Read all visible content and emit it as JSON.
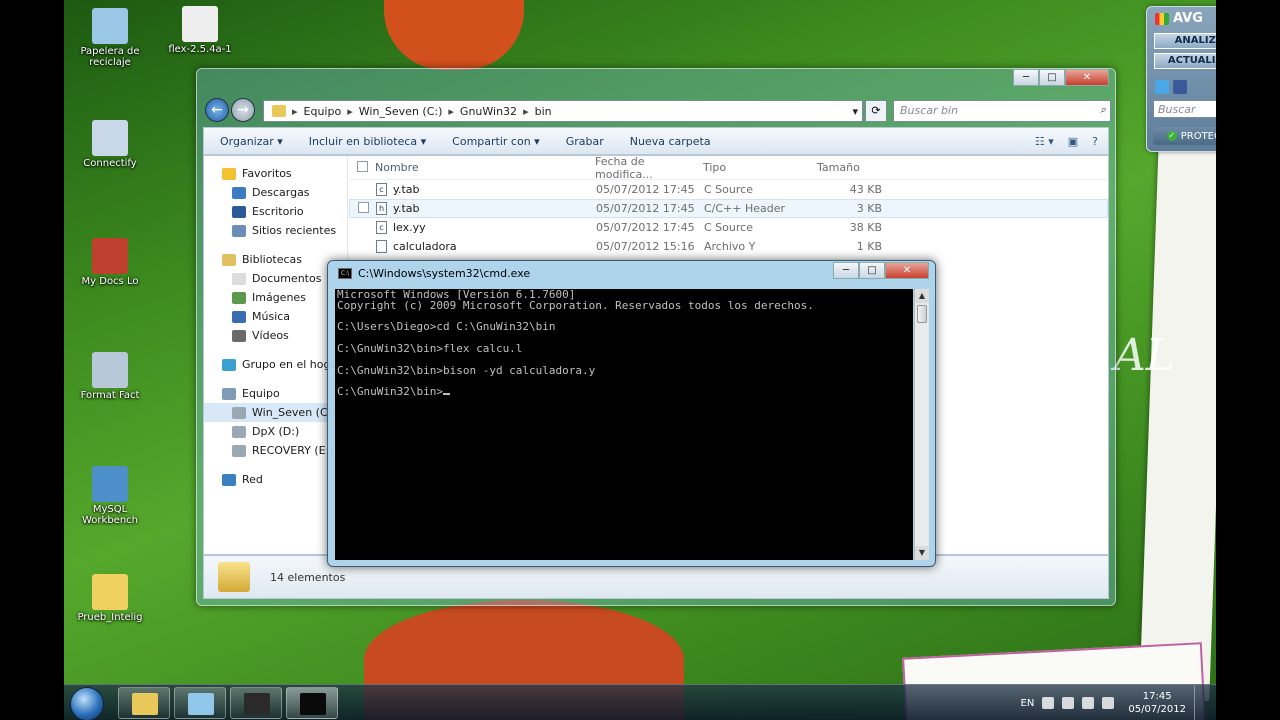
{
  "desktop": {
    "icons": [
      {
        "label": "Papelera de reciclaje",
        "color": "#9cc8e8"
      },
      {
        "label": "flex-2.5.4a-1",
        "color": "#eeeeee"
      },
      {
        "label": "Connectify",
        "color": "#c8d8e8"
      },
      {
        "label": "My Docs Lo",
        "color": "#c04030"
      },
      {
        "label": "Format Fact",
        "color": "#b8c8d8"
      },
      {
        "label": "MySQL Workbench",
        "color": "#4d8fc8"
      },
      {
        "label": "Prueb_Intelig",
        "color": "#f0d060"
      }
    ]
  },
  "explorer": {
    "caption": {
      "minimize": "─",
      "maximize": "□",
      "close": "✕"
    },
    "breadcrumb": [
      "Equipo",
      "Win_Seven (C:)",
      "GnuWin32",
      "bin"
    ],
    "search_placeholder": "Buscar bin",
    "toolbar": [
      "Organizar ▾",
      "Incluir en biblioteca ▾",
      "Compartir con ▾",
      "Grabar",
      "Nueva carpeta"
    ],
    "nav": [
      {
        "label": "Favoritos",
        "level": 0,
        "color": "#f2c230"
      },
      {
        "label": "Descargas",
        "level": 1,
        "color": "#3d7cc0"
      },
      {
        "label": "Escritorio",
        "level": 1,
        "color": "#2c5a96"
      },
      {
        "label": "Sitios recientes",
        "level": 1,
        "color": "#6b8db8"
      },
      {
        "label": "Bibliotecas",
        "level": 0,
        "gap": true,
        "color": "#e0c060"
      },
      {
        "label": "Documentos",
        "level": 1,
        "color": "#dcdcdc"
      },
      {
        "label": "Imágenes",
        "level": 1,
        "color": "#5b9a4c"
      },
      {
        "label": "Música",
        "level": 1,
        "color": "#3a6db0"
      },
      {
        "label": "Vídeos",
        "level": 1,
        "color": "#6a6a6a"
      },
      {
        "label": "Grupo en el hogar",
        "level": 0,
        "gap": true,
        "color": "#3aa0d0"
      },
      {
        "label": "Equipo",
        "level": 0,
        "gap": true,
        "color": "#7f9bb5"
      },
      {
        "label": "Win_Seven (C:)",
        "level": 1,
        "selected": true,
        "color": "#9aa8b4"
      },
      {
        "label": "DpX (D:)",
        "level": 1,
        "color": "#9aa8b4"
      },
      {
        "label": "RECOVERY (E:)",
        "level": 1,
        "color": "#9aa8b4"
      },
      {
        "label": "Red",
        "level": 0,
        "gap": true,
        "color": "#3a7fc0"
      }
    ],
    "columns": [
      "Nombre",
      "Fecha de modifica...",
      "Tipo",
      "Tamaño"
    ],
    "files": [
      {
        "icon": "c",
        "name": "y.tab",
        "date": "05/07/2012 17:45",
        "type": "C Source",
        "size": "43 KB"
      },
      {
        "icon": "h",
        "name": "y.tab",
        "date": "05/07/2012 17:45",
        "type": "C/C++ Header",
        "size": "3 KB",
        "hover": true
      },
      {
        "icon": "c",
        "name": "lex.yy",
        "date": "05/07/2012 17:45",
        "type": "C Source",
        "size": "38 KB"
      },
      {
        "icon": "",
        "name": "calculadora",
        "date": "05/07/2012 15:16",
        "type": "Archivo Y",
        "size": "1 KB"
      }
    ],
    "status_text": "14 elementos"
  },
  "cmd": {
    "title": "C:\\Windows\\system32\\cmd.exe",
    "icon_text": "C:\\",
    "caption": {
      "minimize": "─",
      "maximize": "□",
      "close": "✕"
    },
    "lines": [
      "Microsoft Windows [Versión 6.1.7600]",
      "Copyright (c) 2009 Microsoft Corporation. Reservados todos los derechos.",
      "",
      "C:\\Users\\Diego>cd C:\\GnuWin32\\bin",
      "",
      "C:\\GnuWin32\\bin>flex calcu.l",
      "",
      "C:\\GnuWin32\\bin>bison -yd calculadora.y",
      "",
      "C:\\GnuWin32\\bin>"
    ]
  },
  "avg": {
    "logo": "AVG",
    "scan": "ANALIZAR",
    "update": "ACTUALIZAR",
    "search_placeholder": "Buscar",
    "status": "PROTEGIDO"
  },
  "taskbar": {
    "apps": [
      {
        "name": "explorer",
        "color": "#e8c858"
      },
      {
        "name": "notepad",
        "color": "#8fc6ea"
      },
      {
        "name": "camera",
        "color": "#2a2a2a"
      },
      {
        "name": "cmd",
        "color": "#0a0a0a",
        "active": true
      }
    ],
    "lang": "EN",
    "time": "17:45",
    "date": "05/07/2012"
  }
}
